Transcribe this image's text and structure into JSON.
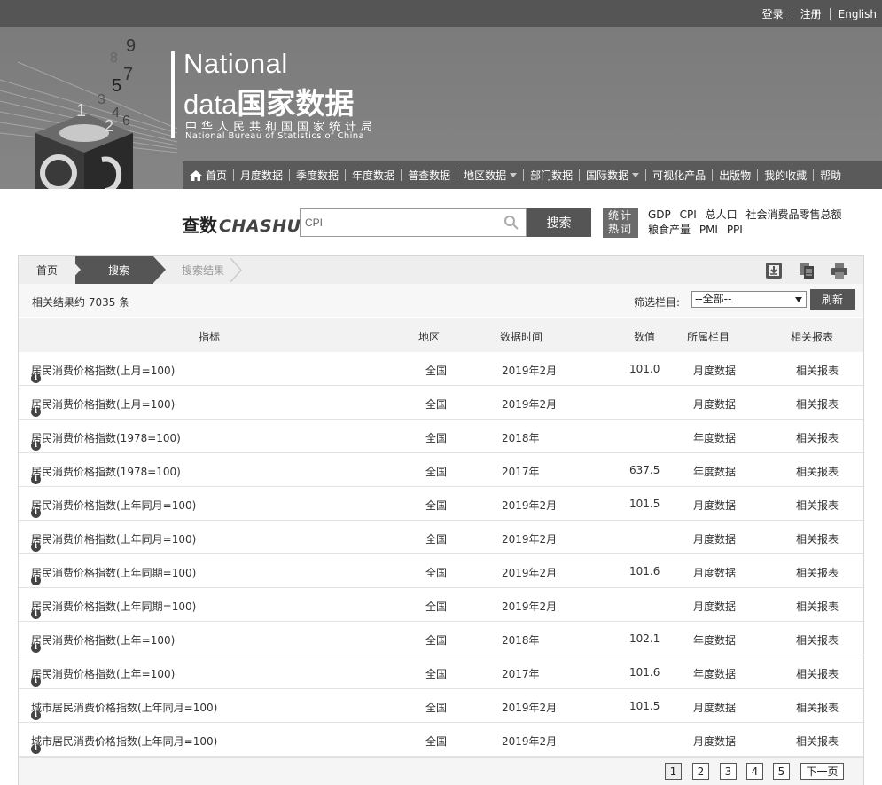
{
  "toplinks": {
    "login": "登录",
    "register": "注册",
    "english": "English"
  },
  "logo": {
    "national": "National",
    "data": "data",
    "cn_title": "国家数据",
    "cn_sub": "中华人民共和国国家统计局",
    "en_sub": "National Bureau of Statistics of China",
    "cube_digits": [
      "9",
      "8",
      "7",
      "5",
      "1",
      "3",
      "4",
      "2",
      "6"
    ]
  },
  "nav": {
    "items": [
      "首页",
      "月度数据",
      "季度数据",
      "年度数据",
      "普查数据",
      "地区数据",
      "部门数据",
      "国际数据",
      "可视化产品",
      "出版物",
      "我的收藏",
      "帮助"
    ]
  },
  "search": {
    "logo_cn": "查数",
    "logo_en": "CHASHU",
    "value": "CPI",
    "button": "搜索",
    "hot_label_line1": "统计",
    "hot_label_line2": "热词",
    "hot_words": [
      "GDP",
      "CPI",
      "总人口",
      "社会消费品零售总额",
      "粮食产量",
      "PMI",
      "PPI"
    ]
  },
  "breadcrumb": {
    "home": "首页",
    "search": "搜索",
    "result": "搜索结果"
  },
  "results": {
    "count_text": "相关结果约 7035 条",
    "filter_label": "筛选栏目:",
    "filter_value": "--全部--",
    "refresh": "刷新"
  },
  "table": {
    "headers": [
      "指标",
      "地区",
      "数据时间",
      "数值",
      "所属栏目",
      "相关报表"
    ],
    "rows": [
      {
        "name": "居民消费价格指数(上月=100)",
        "region": "全国",
        "time": "2019年2月",
        "value": "101.0",
        "column": "月度数据",
        "related": "相关报表"
      },
      {
        "name": "居民消费价格指数(上月=100)",
        "region": "全国",
        "time": "2019年2月",
        "value": "",
        "column": "月度数据",
        "related": "相关报表"
      },
      {
        "name": "居民消费价格指数(1978=100)",
        "region": "全国",
        "time": "2018年",
        "value": "",
        "column": "年度数据",
        "related": "相关报表"
      },
      {
        "name": "居民消费价格指数(1978=100)",
        "region": "全国",
        "time": "2017年",
        "value": "637.5",
        "column": "年度数据",
        "related": "相关报表"
      },
      {
        "name": "居民消费价格指数(上年同月=100)",
        "region": "全国",
        "time": "2019年2月",
        "value": "101.5",
        "column": "月度数据",
        "related": "相关报表"
      },
      {
        "name": "居民消费价格指数(上年同月=100)",
        "region": "全国",
        "time": "2019年2月",
        "value": "",
        "column": "月度数据",
        "related": "相关报表"
      },
      {
        "name": "居民消费价格指数(上年同期=100)",
        "region": "全国",
        "time": "2019年2月",
        "value": "101.6",
        "column": "月度数据",
        "related": "相关报表"
      },
      {
        "name": "居民消费价格指数(上年同期=100)",
        "region": "全国",
        "time": "2019年2月",
        "value": "",
        "column": "月度数据",
        "related": "相关报表"
      },
      {
        "name": "居民消费价格指数(上年=100)",
        "region": "全国",
        "time": "2018年",
        "value": "102.1",
        "column": "年度数据",
        "related": "相关报表"
      },
      {
        "name": "居民消费价格指数(上年=100)",
        "region": "全国",
        "time": "2017年",
        "value": "101.6",
        "column": "年度数据",
        "related": "相关报表"
      },
      {
        "name": "城市居民消费价格指数(上年同月=100)",
        "region": "全国",
        "time": "2019年2月",
        "value": "101.5",
        "column": "月度数据",
        "related": "相关报表"
      },
      {
        "name": "城市居民消费价格指数(上年同月=100)",
        "region": "全国",
        "time": "2019年2月",
        "value": "",
        "column": "月度数据",
        "related": "相关报表"
      }
    ]
  },
  "pager": {
    "pages": [
      "1",
      "2",
      "3",
      "4",
      "5"
    ],
    "next": "下一页"
  },
  "icons": [
    "home-icon",
    "search-icon",
    "download-icon",
    "copy-icon",
    "print-icon",
    "info-icon"
  ],
  "colors": {
    "topbar": "#555555",
    "header": "#808080",
    "nav": "#5a5a5a",
    "button": "#555555"
  }
}
